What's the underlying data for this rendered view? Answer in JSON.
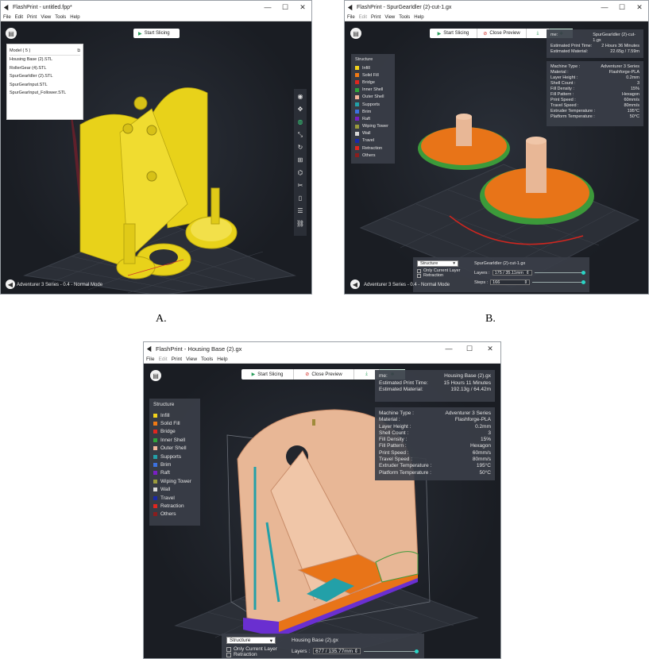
{
  "app": {
    "menu": [
      "File",
      "Edit",
      "Print",
      "View",
      "Tools",
      "Help"
    ],
    "win_controls": [
      "—",
      "☐",
      "✕"
    ]
  },
  "captions": [
    "A.",
    "B."
  ],
  "panelA": {
    "title": "FlashPrint - untitled.fpp*",
    "start_slicing": "Start Slicing",
    "model_header": "Model ( 5 )",
    "models": [
      "Housing Base (2).STL",
      "RollerGear (4).STL",
      "SpurGearIdler (2).STL",
      "SpurGearInput.STL",
      "SpurGearInput_Follower.STL"
    ],
    "status": "Adventurer 3 Series - 0.4 - Normal Mode",
    "tool_icons": [
      "eye-icon",
      "move-icon",
      "view-icon",
      "scale-icon",
      "rotate-icon",
      "add-icon",
      "support-icon",
      "cut-icon",
      "extruder-icon",
      "layers-icon",
      "link-icon"
    ]
  },
  "panelB": {
    "title": "FlashPrint - SpurGearIdler (2)-cut-1.gx",
    "start_slicing": "Start Slicing",
    "close_preview": "Close Preview",
    "summary": [
      [
        "me:",
        "SpurGearIdler (2)-cut-1.gx"
      ],
      [
        "Estimated Print Time:",
        "2 Hours 36 Minutes"
      ],
      [
        "Estimated Material:",
        "22.65g / 7.59m"
      ]
    ],
    "machine": [
      [
        "Machine Type :",
        "Adventurer 3 Series"
      ],
      [
        "Material :",
        "Flashforge-PLA"
      ],
      [
        "Layer Height :",
        "0.2mm"
      ],
      [
        "Shell Count :",
        "3"
      ],
      [
        "Fill Density :",
        "15%"
      ],
      [
        "Fill Pattern :",
        "Hexagon"
      ],
      [
        "Print Speed :",
        "60mm/s"
      ],
      [
        "Travel Speed :",
        "80mm/s"
      ],
      [
        "Extruder Temperature :",
        "195°C"
      ],
      [
        "Platform Temperature :",
        "50°C"
      ]
    ],
    "structure_select": "Structure",
    "only_current_layer": "Only Current Layer",
    "retraction": "Retraction",
    "file_label": "SpurGearIdler (2)-cut-1.gx",
    "layers_label": "Layers :",
    "layers_value": "175 / 35.11mm",
    "steps_label": "Steps :",
    "steps_value": "166",
    "status": "Adventurer 3 Series - 0.4 - Normal Mode"
  },
  "panelC": {
    "title": "FlashPrint - Housing Base (2).gx",
    "start_slicing": "Start Slicing",
    "close_preview": "Close Preview",
    "summary": [
      [
        "me:",
        "Housing Base (2).gx"
      ],
      [
        "Estimated Print Time:",
        "15 Hours 11 Minutes"
      ],
      [
        "Estimated Material:",
        "192.13g / 64.42m"
      ]
    ],
    "machine": [
      [
        "Machine Type :",
        "Adventurer 3 Series"
      ],
      [
        "Material :",
        "Flashforge-PLA"
      ],
      [
        "Layer Height :",
        "0.2mm"
      ],
      [
        "Shell Count :",
        "3"
      ],
      [
        "Fill Density :",
        "15%"
      ],
      [
        "Fill Pattern :",
        "Hexagon"
      ],
      [
        "Print Speed :",
        "60mm/s"
      ],
      [
        "Travel Speed :",
        "80mm/s"
      ],
      [
        "Extruder Temperature :",
        "195°C"
      ],
      [
        "Platform Temperature :",
        "50°C"
      ]
    ],
    "structure_select": "Structure",
    "only_current_layer": "Only Current Layer",
    "retraction": "Retraction",
    "file_label": "Housing Base (2).gx",
    "layers_label": "Layers :",
    "layers_value": "677 / 135.77mm"
  },
  "legend": {
    "title": "Structure",
    "items": [
      {
        "label": "Infill",
        "color": "#f2d21b"
      },
      {
        "label": "Solid Fill",
        "color": "#f07a14"
      },
      {
        "label": "Bridge",
        "color": "#e0261f"
      },
      {
        "label": "Inner Shell",
        "color": "#2fa33a"
      },
      {
        "label": "Outer Shell",
        "color": "#f2b59a"
      },
      {
        "label": "Supports",
        "color": "#23a0a8"
      },
      {
        "label": "Brim",
        "color": "#3c72e0"
      },
      {
        "label": "Raft",
        "color": "#7a1fc4"
      },
      {
        "label": "Wiping Tower",
        "color": "#9a9a3c"
      },
      {
        "label": "Wall",
        "color": "#d8d8d8"
      },
      {
        "label": "Travel",
        "color": "#1a2aa8"
      },
      {
        "label": "Retraction",
        "color": "#e0261f"
      },
      {
        "label": "Others",
        "color": "#8a1e1e"
      }
    ]
  }
}
